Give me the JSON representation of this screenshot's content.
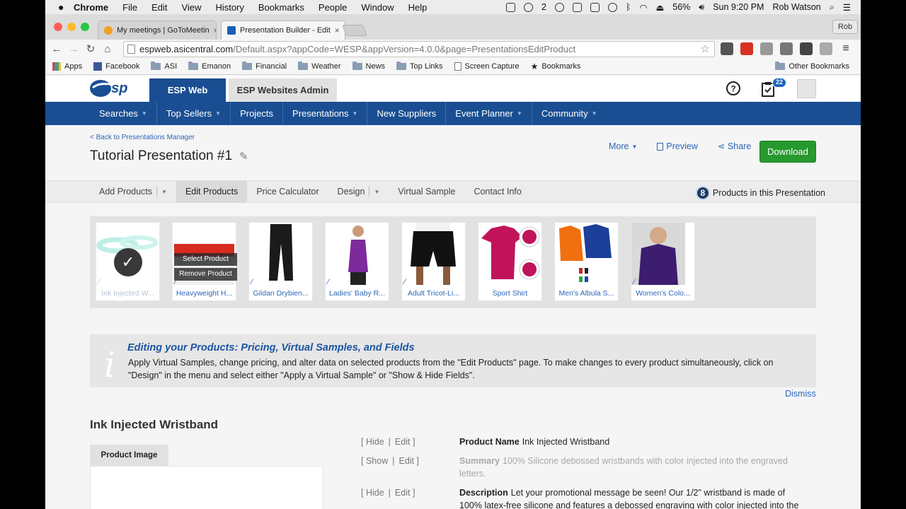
{
  "mac": {
    "menu": [
      "Chrome",
      "File",
      "Edit",
      "View",
      "History",
      "Bookmarks",
      "People",
      "Window",
      "Help"
    ],
    "status_num": "2",
    "battery": "56%",
    "clock": "Sun 9:20 PM",
    "user": "Rob Watson"
  },
  "browser": {
    "tabs": [
      {
        "title": "My meetings | GoToMeetin",
        "close": "×"
      },
      {
        "title": "Presentation Builder - Edit",
        "close": "×"
      }
    ],
    "profile": "Rob",
    "url_host": "espweb.asicentral.com",
    "url_path": "/Default.aspx?appCode=WESP&appVersion=4.0.0&page=PresentationsEditProduct",
    "bookmarks": [
      "Apps",
      "Facebook",
      "ASI",
      "Emanon",
      "Financial",
      "Weather",
      "News",
      "Top Links",
      "Screen Capture",
      "Bookmarks"
    ],
    "other_bookmarks": "Other Bookmarks"
  },
  "header": {
    "logo_text": "esp",
    "app_tabs": [
      "ESP Web",
      "ESP Websites Admin"
    ],
    "notification_count": "22"
  },
  "nav": [
    "Searches",
    "Top Sellers",
    "Projects",
    "Presentations",
    "New Suppliers",
    "Event Planner",
    "Community"
  ],
  "page": {
    "back_link": "< Back to Presentations Manager",
    "title": "Tutorial Presentation #1",
    "actions": {
      "more": "More",
      "preview": "Preview",
      "share": "Share",
      "download": "Download"
    }
  },
  "subnav": {
    "items": [
      "Add Products",
      "Edit Products",
      "Price Calculator",
      "Design",
      "Virtual Sample",
      "Contact Info"
    ],
    "product_count": "8",
    "product_count_label": "Products in this Presentation"
  },
  "products": [
    {
      "label": "Ink Injected W..."
    },
    {
      "label": "Heavyweight H...",
      "overlay_select": "Select Product",
      "overlay_remove": "Remove Product"
    },
    {
      "label": "Gildan Drybien..."
    },
    {
      "label": "Ladies' Baby R..."
    },
    {
      "label": "Adult Tricot-Li..."
    },
    {
      "label": "Sport Shirt"
    },
    {
      "label": "Men's Albula S..."
    },
    {
      "label": "Women's Colo..."
    }
  ],
  "info": {
    "heading": "Editing your Products: Pricing, Virtual Samples, and Fields",
    "body": "Apply Virtual Samples, change pricing, and alter data on selected products from the \"Edit Products\" page. To make changes to every product simultaneously, click on \"Design\" in the menu and select either \"Apply a Virtual Sample\" or \"Show & Hide Fields\".",
    "dismiss": "Dismiss"
  },
  "product": {
    "name": "Ink Injected Wristband",
    "image_tab": "Product Image",
    "fields": [
      {
        "toggle": "Hide",
        "edit": "Edit",
        "label": "Product Name",
        "value": "Ink Injected Wristband"
      },
      {
        "toggle": "Show",
        "edit": "Edit",
        "label": "Summary",
        "value": "100% Silicone debossed wristbands with color injected into the engraved letters."
      },
      {
        "toggle": "Hide",
        "edit": "Edit",
        "label": "Description",
        "value": "Let your promotional message be seen! Our 1/2\" wristband is made of 100% latex-free silicone and features a debossed engraving with color injected into the"
      }
    ]
  }
}
